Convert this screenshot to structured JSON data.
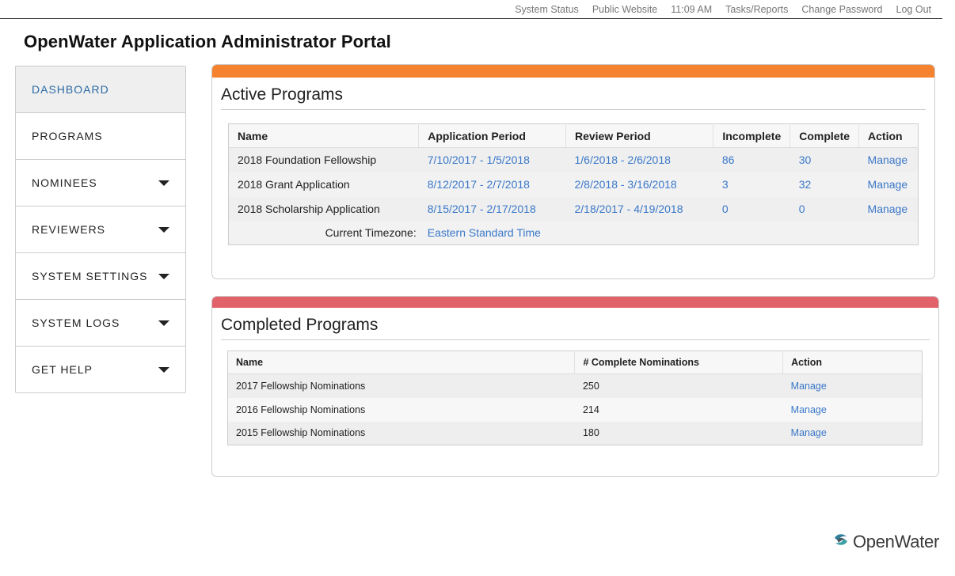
{
  "topnav": {
    "system_status": "System Status",
    "public_website": "Public Website",
    "time": "11:09 AM",
    "tasks_reports": "Tasks/Reports",
    "change_password": "Change Password",
    "log_out": "Log Out"
  },
  "page_title": "OpenWater Application Administrator Portal",
  "sidebar": {
    "items": [
      {
        "label": "DASHBOARD",
        "active": true,
        "has_caret": false
      },
      {
        "label": "PROGRAMS",
        "active": false,
        "has_caret": false
      },
      {
        "label": "NOMINEES",
        "active": false,
        "has_caret": true
      },
      {
        "label": "REVIEWERS",
        "active": false,
        "has_caret": true
      },
      {
        "label": "SYSTEM SETTINGS",
        "active": false,
        "has_caret": true
      },
      {
        "label": "SYSTEM LOGS",
        "active": false,
        "has_caret": true
      },
      {
        "label": "GET HELP",
        "active": false,
        "has_caret": true
      }
    ]
  },
  "active_programs": {
    "title": "Active Programs",
    "accent_color": "#f5822e",
    "columns": [
      "Name",
      "Application Period",
      "Review Period",
      "Incomplete",
      "Complete",
      "Action"
    ],
    "rows": [
      {
        "name": "2018 Foundation Fellowship",
        "application_period": "7/10/2017 - 1/5/2018",
        "review_period": "1/6/2018 - 2/6/2018",
        "incomplete": "86",
        "complete": "30",
        "action": "Manage"
      },
      {
        "name": "2018 Grant Application",
        "application_period": "8/12/2017 - 2/7/2018",
        "review_period": "2/8/2018 - 3/16/2018",
        "incomplete": "3",
        "complete": "32",
        "action": "Manage"
      },
      {
        "name": "2018 Scholarship Application",
        "application_period": "8/15/2017 - 2/17/2018",
        "review_period": "2/18/2017 - 4/19/2018",
        "incomplete": "0",
        "complete": "0",
        "action": "Manage"
      }
    ],
    "timezone_label": "Current Timezone:",
    "timezone_value": "Eastern Standard Time"
  },
  "completed_programs": {
    "title": "Completed Programs",
    "accent_color": "#e2626a",
    "columns": [
      "Name",
      "# Complete Nominations",
      "Action"
    ],
    "rows": [
      {
        "name": "2017 Fellowship Nominations",
        "count": "250",
        "action": "Manage"
      },
      {
        "name": "2016 Fellowship Nominations",
        "count": "214",
        "action": "Manage"
      },
      {
        "name": "2015 Fellowship Nominations",
        "count": "180",
        "action": "Manage"
      }
    ]
  },
  "footer": {
    "logo_text": "OpenWater",
    "logo_icon": "openwater-logo-icon"
  },
  "colors": {
    "link": "#3a78c9",
    "active_nav": "#2b6aa6"
  }
}
